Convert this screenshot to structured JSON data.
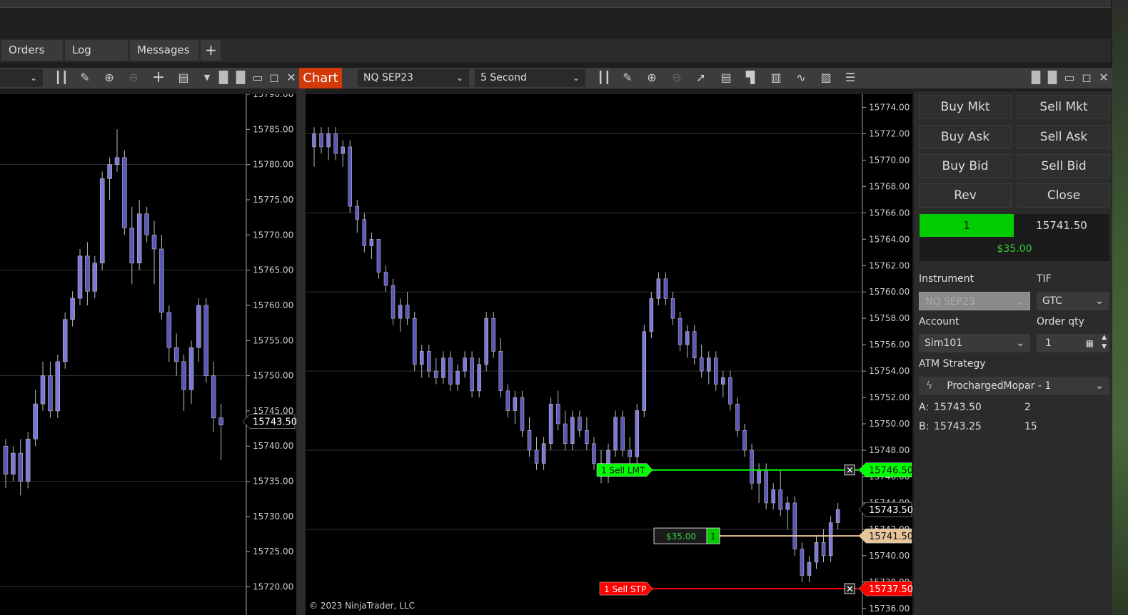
{
  "tabs": [
    {
      "label": "Orders"
    },
    {
      "label": "Log"
    },
    {
      "label": "Messages"
    }
  ],
  "add_tab_icon": "plus-icon",
  "toolbar": {
    "chart_tab": "Chart",
    "instrument": "NQ SEP23",
    "interval": "5 Second",
    "icons": [
      "bar-type-icon",
      "drawing-tools-icon",
      "zoom-in-icon",
      "zoom-out-icon",
      "pointer-icon",
      "data-box-icon",
      "chart-trader-icon",
      "properties-icon",
      "strategies-icon",
      "indicators-icon",
      "object-list-icon"
    ]
  },
  "chart": {
    "copyright": "© 2023 NinjaTrader, LLC"
  },
  "orders": {
    "sell_lmt": {
      "label": "1  Sell LMT",
      "price": "15746.50",
      "color": "#00ff00"
    },
    "sell_stp": {
      "label": "1  Sell STP",
      "price": "15737.50",
      "color": "#ff0000"
    },
    "position": {
      "pnl": "$35.00",
      "qty": "1",
      "price": "15741.50",
      "color": "#e8c49a"
    },
    "last_price": "15743.50"
  },
  "left_chart": {
    "last_price": "15743.50"
  },
  "panel": {
    "buttons": [
      [
        "Buy Mkt",
        "Sell Mkt"
      ],
      [
        "Buy Ask",
        "Sell Ask"
      ],
      [
        "Buy Bid",
        "Sell Bid"
      ],
      [
        "Rev",
        "Close"
      ]
    ],
    "position_qty": "1",
    "position_price": "15741.50",
    "pnl": "$35.00",
    "instrument_label": "Instrument",
    "instrument": "NQ SEP23",
    "tif_label": "TIF",
    "tif": "GTC",
    "account_label": "Account",
    "account": "Sim101",
    "qty_label": "Order qty",
    "qty": "1",
    "atm_label": "ATM Strategy",
    "atm": "ProchargedMopar - 1",
    "ask_label": "A:",
    "ask": "15743.50",
    "ask_size": "2",
    "bid_label": "B:",
    "bid": "15743.25",
    "bid_size": "15"
  },
  "colors": {
    "candle": "#7b78d8",
    "accent": "#d33a0a",
    "green": "#00cc00"
  },
  "chart_data": [
    {
      "type": "candlestick",
      "name": "NQ SEP23 5 Second",
      "ylim": [
        15735.5,
        15775
      ],
      "yticks_step": 2,
      "ohlc": [
        [
          15771,
          15772.5,
          15769.5,
          15772
        ],
        [
          15772,
          15772.5,
          15770.5,
          15771
        ],
        [
          15771,
          15772.5,
          15770,
          15772
        ],
        [
          15772,
          15772.5,
          15770,
          15770.5
        ],
        [
          15770.5,
          15771.5,
          15769.5,
          15771
        ],
        [
          15771,
          15771.5,
          15766,
          15766.5
        ],
        [
          15766.5,
          15767,
          15764.5,
          15765.5
        ],
        [
          15765.5,
          15766,
          15763,
          15763.5
        ],
        [
          15763.5,
          15764.5,
          15762.5,
          15764
        ],
        [
          15764,
          15764,
          15761,
          15761.5
        ],
        [
          15761.5,
          15762,
          15760,
          15760.5
        ],
        [
          15760.5,
          15761,
          15757.5,
          15758
        ],
        [
          15758,
          15759.5,
          15757,
          15759
        ],
        [
          15759,
          15760,
          15757.5,
          15758
        ],
        [
          15758,
          15758.5,
          15754,
          15754.5
        ],
        [
          15754.5,
          15756,
          15753.5,
          15755.5
        ],
        [
          15755.5,
          15756,
          15753.5,
          15754
        ],
        [
          15754,
          15755,
          15753,
          15753.5
        ],
        [
          15753.5,
          15755.5,
          15753,
          15755
        ],
        [
          15755,
          15755.5,
          15752.5,
          15753
        ],
        [
          15753,
          15754.5,
          15752.5,
          15754
        ],
        [
          15754,
          15755.5,
          15753.5,
          15755
        ],
        [
          15755,
          15755.5,
          15752,
          15752.5
        ],
        [
          15752.5,
          15755,
          15752,
          15754.5
        ],
        [
          15754.5,
          15758.5,
          15754,
          15758
        ],
        [
          15758,
          15758.5,
          15755,
          15755.5
        ],
        [
          15755.5,
          15756.5,
          15752,
          15752.5
        ],
        [
          15752.5,
          15753,
          15750.5,
          15751
        ],
        [
          15751,
          15752.5,
          15750,
          15752
        ],
        [
          15752,
          15752.5,
          15749,
          15749.5
        ],
        [
          15749.5,
          15750.5,
          15747.5,
          15748
        ],
        [
          15748,
          15749,
          15746.5,
          15747
        ],
        [
          15747,
          15749,
          15746.5,
          15748.5
        ],
        [
          15748.5,
          15752,
          15748,
          15751.5
        ],
        [
          15751.5,
          15752.5,
          15749.5,
          15750
        ],
        [
          15750,
          15751,
          15748,
          15748.5
        ],
        [
          15748.5,
          15751,
          15748,
          15750.5
        ],
        [
          15750.5,
          15751,
          15749,
          15749.5
        ],
        [
          15749.5,
          15750.5,
          15748,
          15748.5
        ],
        [
          15748.5,
          15749,
          15746.5,
          15747
        ],
        [
          15747,
          15748,
          15745.5,
          15746
        ],
        [
          15746,
          15748.5,
          15745.5,
          15748
        ],
        [
          15748,
          15751,
          15747.5,
          15750.5
        ],
        [
          15750.5,
          15751,
          15747.5,
          15748
        ],
        [
          15748,
          15749,
          15747,
          15747.5
        ],
        [
          15747.5,
          15751.5,
          15747,
          15751
        ],
        [
          15751,
          15757.5,
          15750.5,
          15757
        ],
        [
          15757,
          15760,
          15756.5,
          15759.5
        ],
        [
          15759.5,
          15761.5,
          15759,
          15761
        ],
        [
          15761,
          15761.5,
          15759,
          15759.5
        ],
        [
          15759.5,
          15760,
          15757.5,
          15758
        ],
        [
          15758,
          15758.5,
          15755.5,
          15756
        ],
        [
          15756,
          15757.5,
          15755,
          15757
        ],
        [
          15757,
          15757.5,
          15754.5,
          15755
        ],
        [
          15755,
          15756,
          15753.5,
          15754
        ],
        [
          15754,
          15755.5,
          15753,
          15755
        ],
        [
          15755,
          15755.5,
          15752.5,
          15753
        ],
        [
          15753,
          15754,
          15752,
          15753.5
        ],
        [
          15753.5,
          15754,
          15751,
          15751.5
        ],
        [
          15751.5,
          15752,
          15749,
          15749.5
        ],
        [
          15749.5,
          15750,
          15747.5,
          15748
        ],
        [
          15748,
          15748.5,
          15745,
          15745.5
        ],
        [
          15745.5,
          15747,
          15744,
          15746.5
        ],
        [
          15746.5,
          15747,
          15743.5,
          15744
        ],
        [
          15744,
          15745.5,
          15743.5,
          15745
        ],
        [
          15745,
          15746.5,
          15743,
          15743.5
        ],
        [
          15743.5,
          15744.5,
          15742,
          15744
        ],
        [
          15744,
          15744.5,
          15740,
          15740.5
        ],
        [
          15740.5,
          15741,
          15738,
          15738.5
        ],
        [
          15738.5,
          15740,
          15738,
          15739.5
        ],
        [
          15739.5,
          15741.5,
          15739,
          15741
        ],
        [
          15741,
          15742,
          15739.5,
          15740
        ],
        [
          15740,
          15743,
          15739.5,
          15742.5
        ],
        [
          15742.5,
          15744,
          15742,
          15743.5
        ]
      ]
    },
    {
      "type": "candlestick",
      "ylim": [
        15716,
        15790
      ],
      "yticks_step": 5,
      "ohlc": [
        [
          15740,
          15741,
          15734,
          15736
        ],
        [
          15736,
          15740,
          15735,
          15739
        ],
        [
          15739,
          15741,
          15733,
          15735
        ],
        [
          15735,
          15742,
          15734,
          15741
        ],
        [
          15741,
          15748,
          15740,
          15746
        ],
        [
          15746,
          15752,
          15745,
          15750
        ],
        [
          15750,
          15752,
          15744,
          15745
        ],
        [
          15745,
          15753,
          15744,
          15752
        ],
        [
          15752,
          15759,
          15751,
          15758
        ],
        [
          15758,
          15762,
          15757,
          15761
        ],
        [
          15761,
          15768,
          15760,
          15767
        ],
        [
          15767,
          15769,
          15760,
          15762
        ],
        [
          15762,
          15767,
          15761,
          15766
        ],
        [
          15766,
          15779,
          15765,
          15778
        ],
        [
          15778,
          15781,
          15775,
          15780
        ],
        [
          15780,
          15785,
          15779,
          15781
        ],
        [
          15781,
          15782,
          15770,
          15771
        ],
        [
          15771,
          15774,
          15763,
          15766
        ],
        [
          15766,
          15775,
          15765,
          15773
        ],
        [
          15773,
          15774,
          15769,
          15770
        ],
        [
          15770,
          15772,
          15763,
          15768
        ],
        [
          15768,
          15770,
          15758,
          15759
        ],
        [
          15759,
          15760,
          15752,
          15754
        ],
        [
          15754,
          15756,
          15750,
          15752
        ],
        [
          15752,
          15753,
          15745,
          15748
        ],
        [
          15748,
          15755,
          15746,
          15754
        ],
        [
          15754,
          15761,
          15752,
          15760
        ],
        [
          15760,
          15761,
          15749,
          15750
        ],
        [
          15750,
          15752,
          15742,
          15744
        ],
        [
          15744,
          15746,
          15738,
          15743
        ]
      ]
    }
  ]
}
